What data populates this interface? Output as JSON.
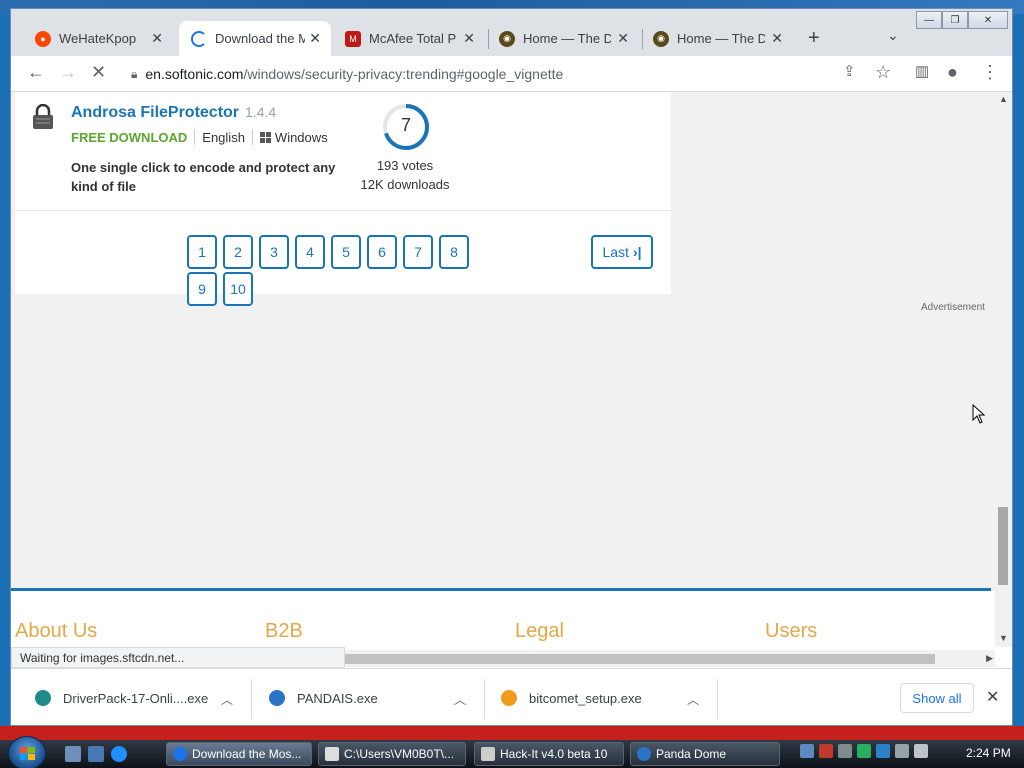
{
  "window_controls": {
    "minimize": "—",
    "restore": "❐",
    "close": "✕"
  },
  "tabs": [
    {
      "title": "WeHateKpop",
      "favicon_color": "#ff4500",
      "active": false
    },
    {
      "title": "Download the M",
      "favicon_color": "#1a73e8",
      "active": true
    },
    {
      "title": "McAfee Total Pro",
      "favicon_color": "#c01818",
      "active": false
    },
    {
      "title": "Home — The Do",
      "favicon_color": "#5a4a1a",
      "active": false
    },
    {
      "title": "Home — The Do",
      "favicon_color": "#5a4a1a",
      "active": false
    }
  ],
  "toolbar": {
    "url_host": "en.softonic.com",
    "url_path": "/windows/security-privacy:trending#google_vignette"
  },
  "app": {
    "name": "Androsa FileProtector",
    "version": "1.4.4",
    "license": "FREE DOWNLOAD",
    "language": "English",
    "platform": "Windows",
    "description": "One single click to encode and protect any kind of file",
    "rating": "7",
    "rating_fraction": 0.7,
    "votes": "193 votes",
    "downloads": "12K downloads"
  },
  "pagination": {
    "pages": [
      "1",
      "2",
      "3",
      "4",
      "5",
      "6",
      "7",
      "8",
      "9",
      "10"
    ],
    "last_label": "Last"
  },
  "advertisement_label": "Advertisement",
  "footer": {
    "headings": [
      "About Us",
      "B2B",
      "Legal",
      "Users"
    ]
  },
  "status_text": "Waiting for images.sftcdn.net...",
  "downloads": [
    {
      "file": "DriverPack-17-Onli....exe",
      "icon_color": "#1f8a8a"
    },
    {
      "file": "PANDAIS.exe",
      "icon_color": "#2a73c7"
    },
    {
      "file": "bitcomet_setup.exe",
      "icon_color": "#f29a1a"
    }
  ],
  "show_all_label": "Show all",
  "taskbar": {
    "tasks": [
      {
        "label": "Download the Mos...",
        "icon_color": "#1a73e8",
        "active": true
      },
      {
        "label": "C:\\Users\\VM0B0T\\...",
        "icon_color": "#dddddd",
        "active": false
      },
      {
        "label": "Hack-It v4.0 beta 10",
        "icon_color": "#cccccc",
        "active": false
      },
      {
        "label": "Panda Dome",
        "icon_color": "#2a73c7",
        "active": false
      }
    ],
    "clock": "2:24 PM"
  },
  "colors": {
    "accent": "#1a74b7",
    "free_green": "#5aa62f",
    "footer_heading": "#e3a84a"
  }
}
